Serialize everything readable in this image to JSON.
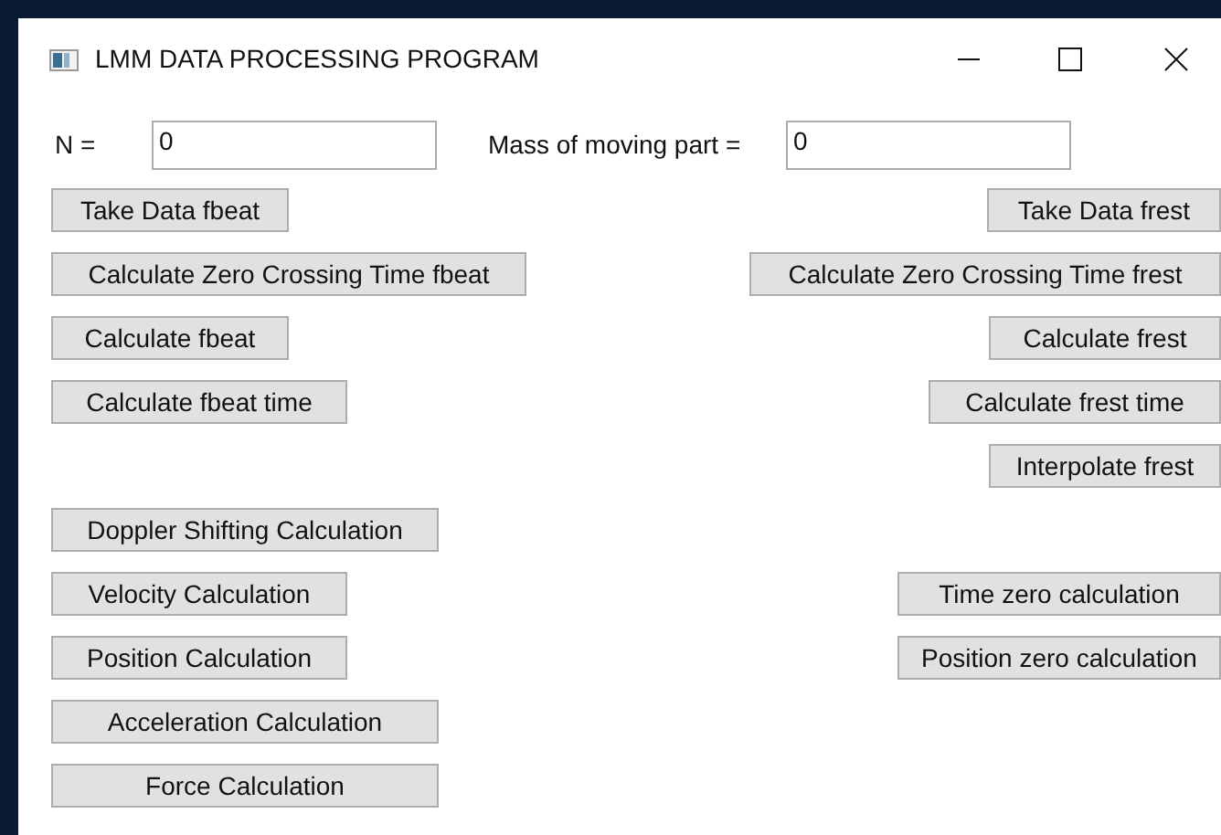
{
  "window": {
    "title": "LMM DATA PROCESSING PROGRAM"
  },
  "fields": [
    {
      "label": "N =",
      "value": "0"
    },
    {
      "label": "Mass of moving part =",
      "value": "0"
    }
  ],
  "rows": [
    {
      "left": "Take Data fbeat",
      "right": "Take Data frest"
    },
    {
      "left": "Calculate Zero Crossing Time fbeat",
      "right": "Calculate Zero Crossing Time frest"
    },
    {
      "left": "Calculate fbeat",
      "right": "Calculate frest"
    },
    {
      "left": "Calculate fbeat time",
      "right": "Calculate frest time"
    },
    {
      "right": "Interpolate frest"
    },
    {
      "left": "Doppler Shifting Calculation"
    },
    {
      "left": "Velocity Calculation",
      "right": "Time zero calculation"
    },
    {
      "left": "Position Calculation",
      "right": "Position zero calculation"
    },
    {
      "left": "Acceleration Calculation"
    },
    {
      "left": "Force Calculation"
    }
  ]
}
